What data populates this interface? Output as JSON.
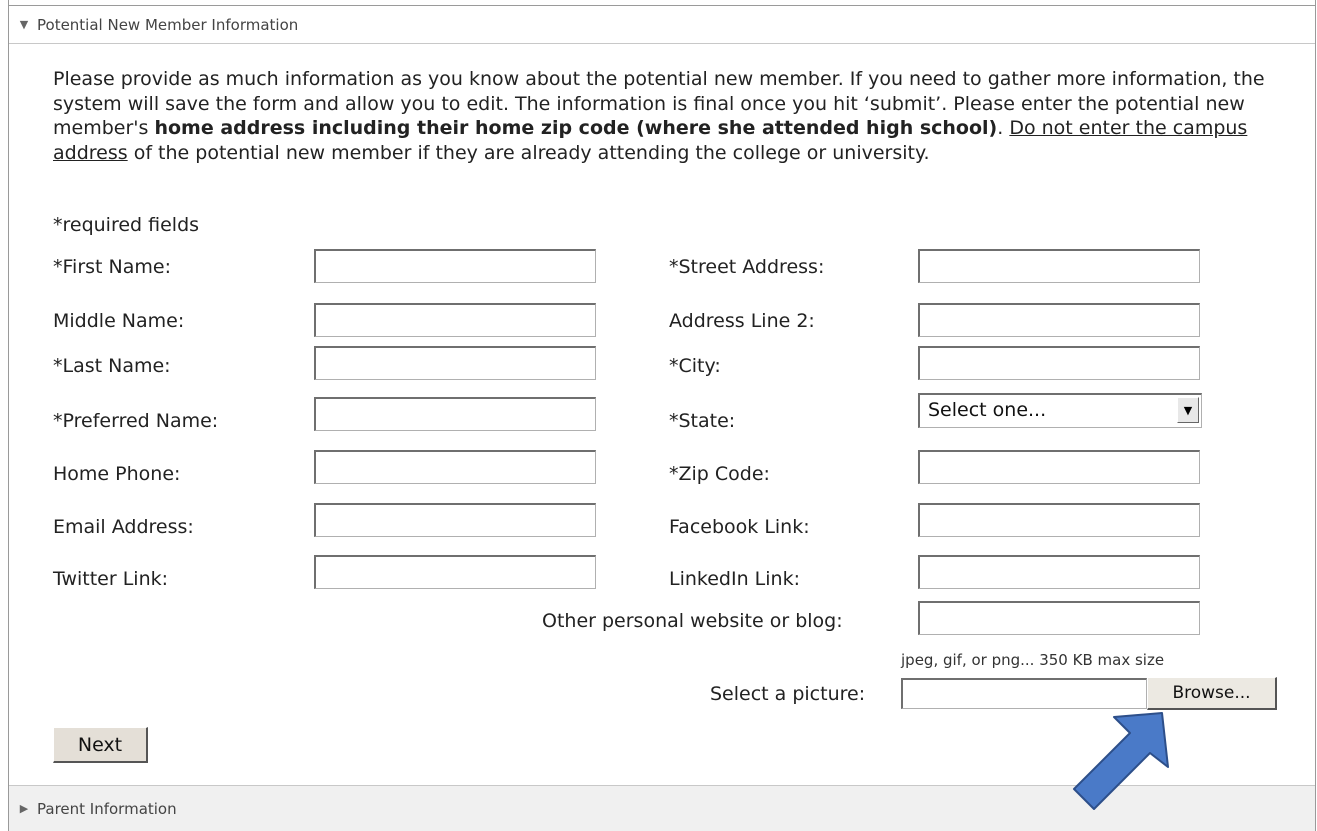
{
  "sections": {
    "current": {
      "title": "Potential New Member Information",
      "caret": "▼"
    },
    "next": {
      "title": "Parent Information",
      "caret": "▶"
    }
  },
  "intro": {
    "part1": "Please provide as much information as you know about the potential new member. If you need to gather more information, the system will save the form and allow you to edit. The information is final once you hit ‘submit’. Please enter the potential new member's ",
    "bold": "home address including their home zip code (where she attended high school)",
    "part2": ". ",
    "underlined": "Do not enter the campus address",
    "part3": " of the potential new member if they are already attending the college or university."
  },
  "required_note": "*required fields",
  "form": {
    "left": [
      {
        "label": "*First Name:",
        "value": ""
      },
      {
        "label": "Middle Name:",
        "value": ""
      },
      {
        "label": "*Last Name:",
        "value": ""
      },
      {
        "label": "*Preferred Name:",
        "value": ""
      },
      {
        "label": "Home Phone:",
        "value": ""
      },
      {
        "label": "Email Address:",
        "value": ""
      },
      {
        "label": "Twitter Link:",
        "value": ""
      }
    ],
    "right": [
      {
        "label": "*Street Address:",
        "value": ""
      },
      {
        "label": "Address Line 2:",
        "value": ""
      },
      {
        "label": "*City:",
        "value": ""
      },
      {
        "label": "*State:",
        "value": "Select one..."
      },
      {
        "label": "*Zip Code:",
        "value": ""
      },
      {
        "label": "Facebook Link:",
        "value": ""
      },
      {
        "label": "LinkedIn Link:",
        "value": ""
      }
    ],
    "other_site_label": "Other personal website or blog:",
    "picture_hint": "jpeg, gif, or png... 350 KB max size",
    "picture_label": "Select a picture:",
    "browse_label": "Browse...",
    "next_label": "Next"
  },
  "icons": {
    "state_dropdown": "chevron-down-icon",
    "annotation": "arrow-pointer-icon"
  },
  "colors": {
    "arrow_fill": "#4a7ac8",
    "arrow_stroke": "#2d4f8a",
    "border": "#9a9a9a"
  }
}
